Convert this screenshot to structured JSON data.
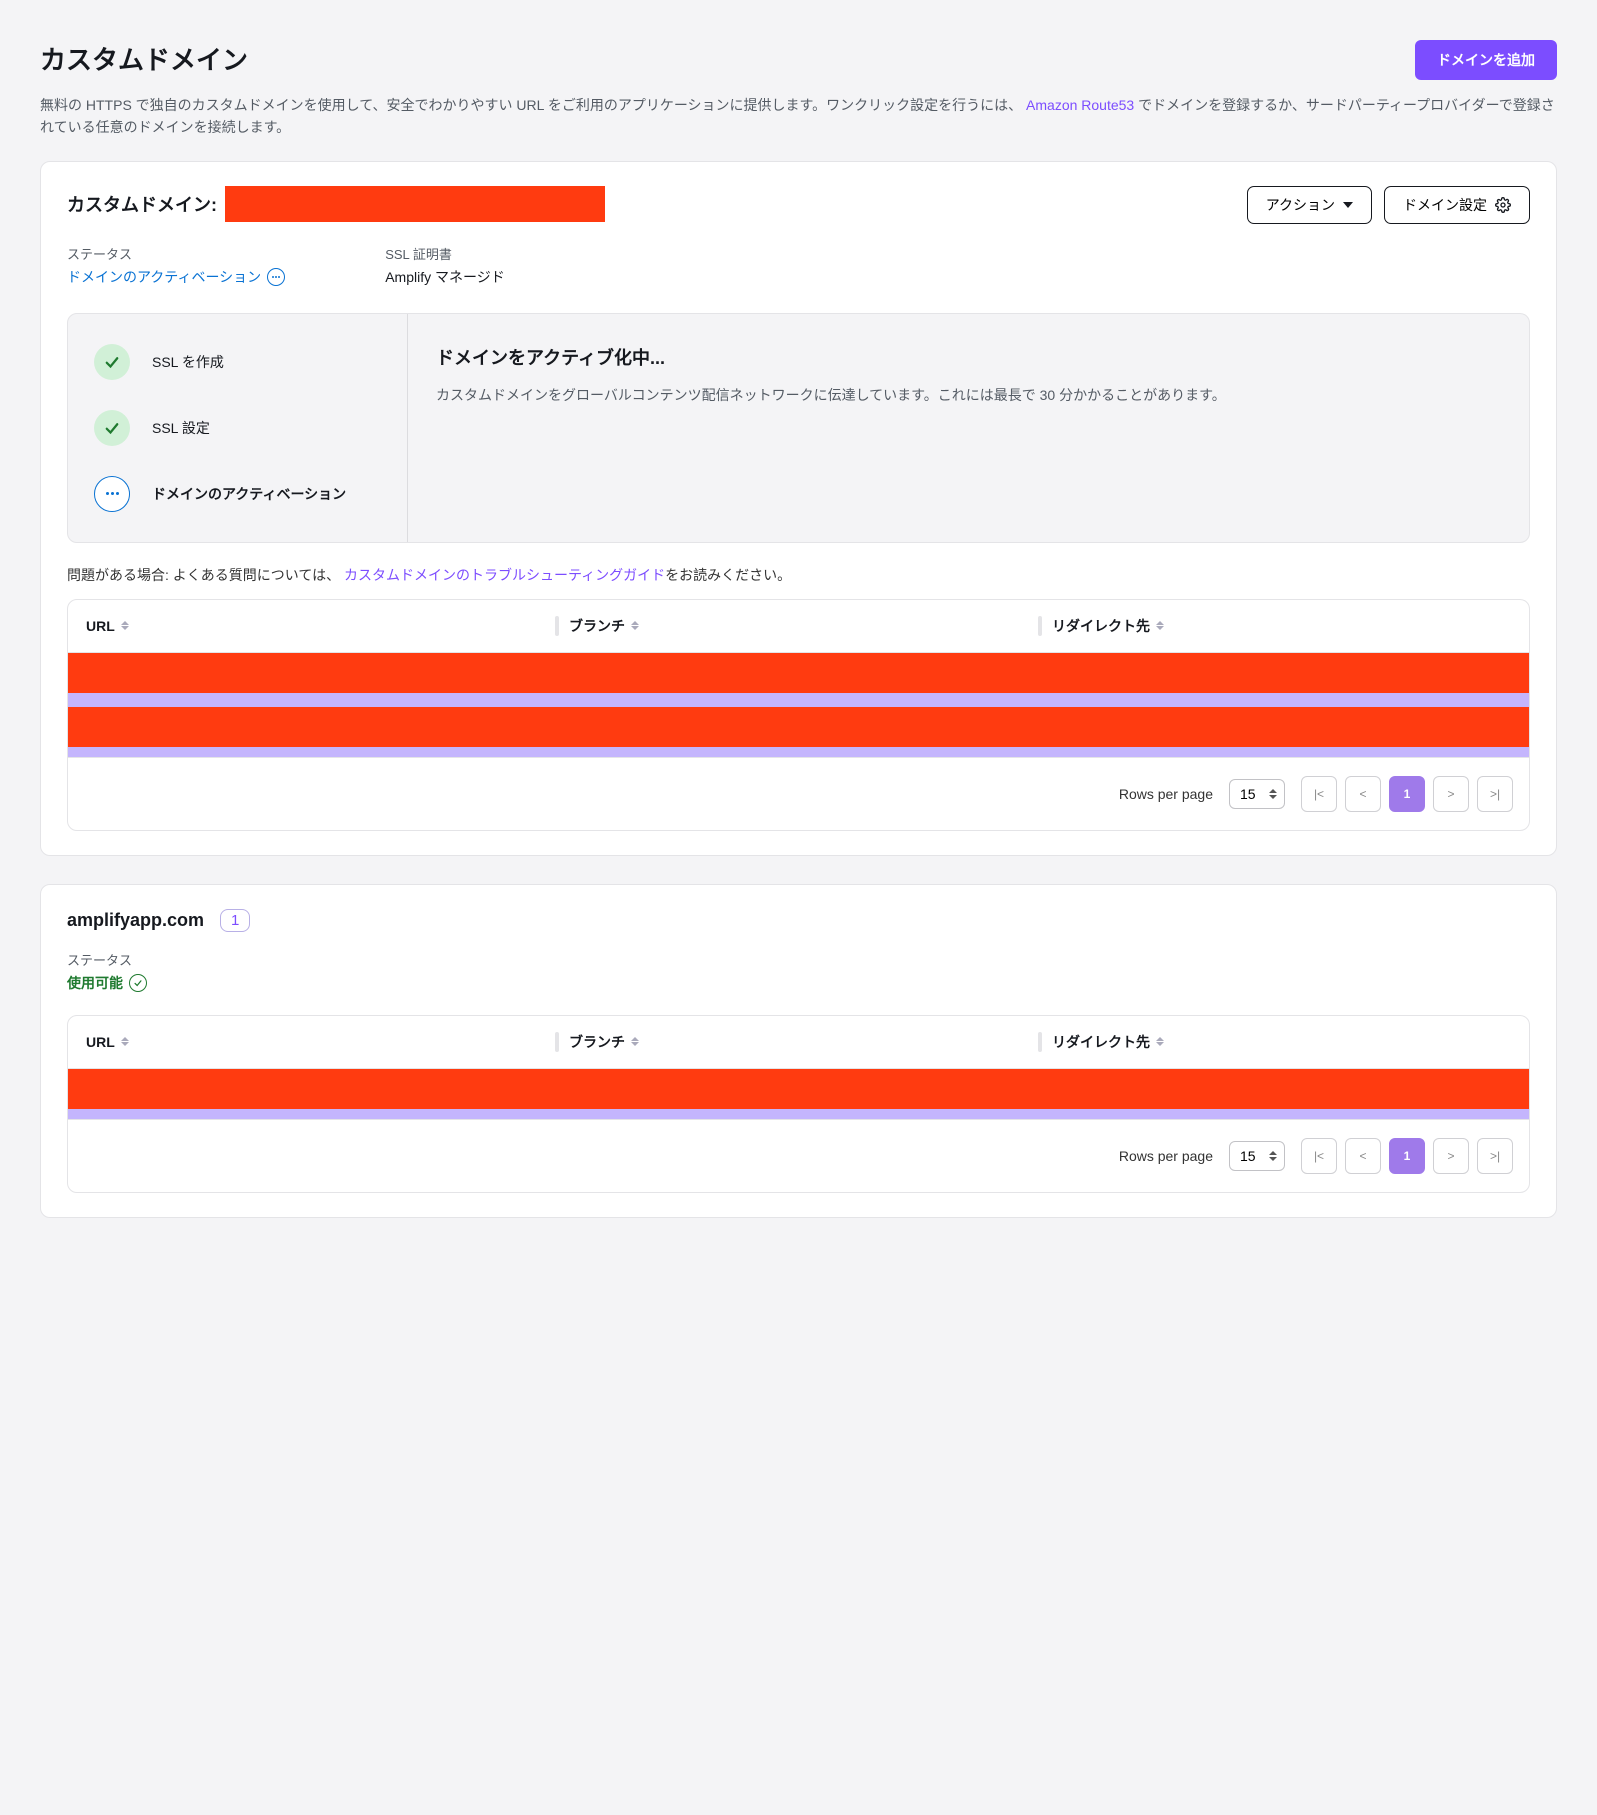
{
  "header": {
    "title": "カスタムドメイン",
    "add_button": "ドメインを追加",
    "desc_part1": "無料の HTTPS で独自のカスタムドメインを使用して、安全でわかりやすい URL をご利用のアプリケーションに提供します。ワンクリック設定を行うには、",
    "desc_link": "Amazon Route53",
    "desc_part2": " でドメインを登録するか、サードパーティープロバイダーで登録されている任意のドメインを接続します。"
  },
  "domain1": {
    "title": "カスタムドメイン:",
    "actions_btn": "アクション",
    "settings_btn": "ドメイン設定",
    "status_label": "ステータス",
    "status_value": "ドメインのアクティベーション",
    "ssl_label": "SSL 証明書",
    "ssl_value": "Amplify マネージド",
    "steps": {
      "ssl_create": "SSL を作成",
      "ssl_config": "SSL 設定",
      "activation": "ドメインのアクティベーション"
    },
    "progress_title": "ドメインをアクティブ化中...",
    "progress_text": "カスタムドメインをグローバルコンテンツ配信ネットワークに伝達しています。これには最長で 30 分かかることがあります。",
    "troubleshoot_prefix": "問題がある場合: よくある質問については、",
    "troubleshoot_link": "カスタムドメインのトラブルシューティングガイド",
    "troubleshoot_suffix": "をお読みください。"
  },
  "table": {
    "col_url": "URL",
    "col_branch": "ブランチ",
    "col_redirect": "リダイレクト先",
    "rows_per_page_label": "Rows per page",
    "rows_per_page_value": "15",
    "current_page": "1"
  },
  "domain2": {
    "title": "amplifyapp.com",
    "badge": "1",
    "status_label": "ステータス",
    "status_value": "使用可能"
  }
}
